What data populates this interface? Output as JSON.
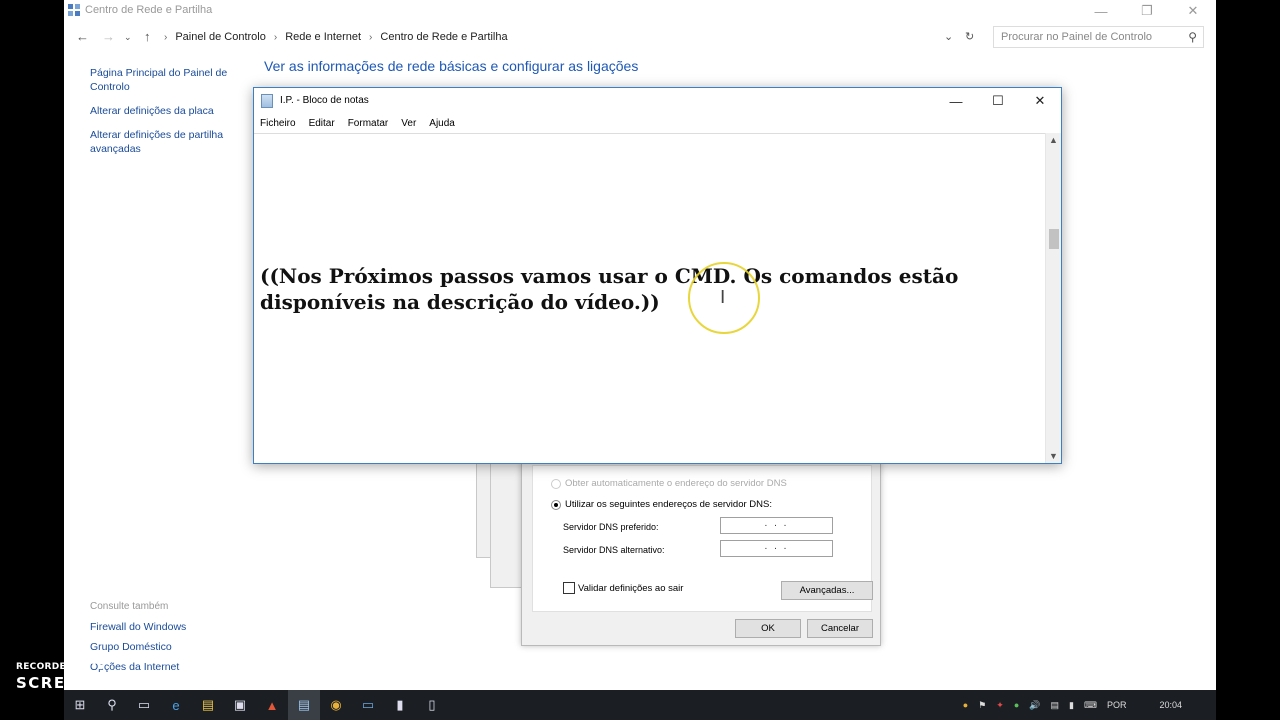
{
  "control_panel": {
    "title": "Centro de Rede e Partilha",
    "breadcrumbs": [
      "Painel de Controlo",
      "Rede e Internet",
      "Centro de Rede e Partilha"
    ],
    "search_placeholder": "Procurar no Painel de Controlo",
    "heading": "Ver as informações de rede básicas e configurar as ligações",
    "sidebar": [
      "Página Principal do Painel de Controlo",
      "Alterar definições da placa",
      "Alterar definições de partilha avançadas"
    ],
    "see_also_heading": "Consulte também",
    "see_also": [
      "Firewall do Windows",
      "Grupo Doméstico",
      "Opções da Internet"
    ]
  },
  "notepad": {
    "title": "I.P. - Bloco de notas",
    "menu": [
      "Ficheiro",
      "Editar",
      "Formatar",
      "Ver",
      "Ajuda"
    ],
    "content": "((Nos Próximos passos vamos usar o CMD. Os comandos estão disponíveis na descrição do vídeo.))"
  },
  "dns_dialog": {
    "radio_auto": "Obter automaticamente o endereço do servidor DNS",
    "radio_manual": "Utilizar os seguintes endereços de servidor DNS:",
    "preferred_label": "Servidor DNS preferido:",
    "alternate_label": "Servidor DNS alternativo:",
    "preferred_value": ". . .",
    "alternate_value": ". . .",
    "validate_label": "Validar definições ao sair",
    "advanced_button": "Avançadas...",
    "ok_button": "OK",
    "cancel_button": "Cancelar"
  },
  "taskbar": {
    "language": "POR",
    "time": "20:04"
  },
  "watermark": {
    "line1": "RECORDED WITH",
    "line2": "SCREENCAST-O-MATIC"
  },
  "colors": {
    "link": "#1a4b99",
    "heading": "#1e58b6",
    "taskbar": "#1b1e22"
  }
}
